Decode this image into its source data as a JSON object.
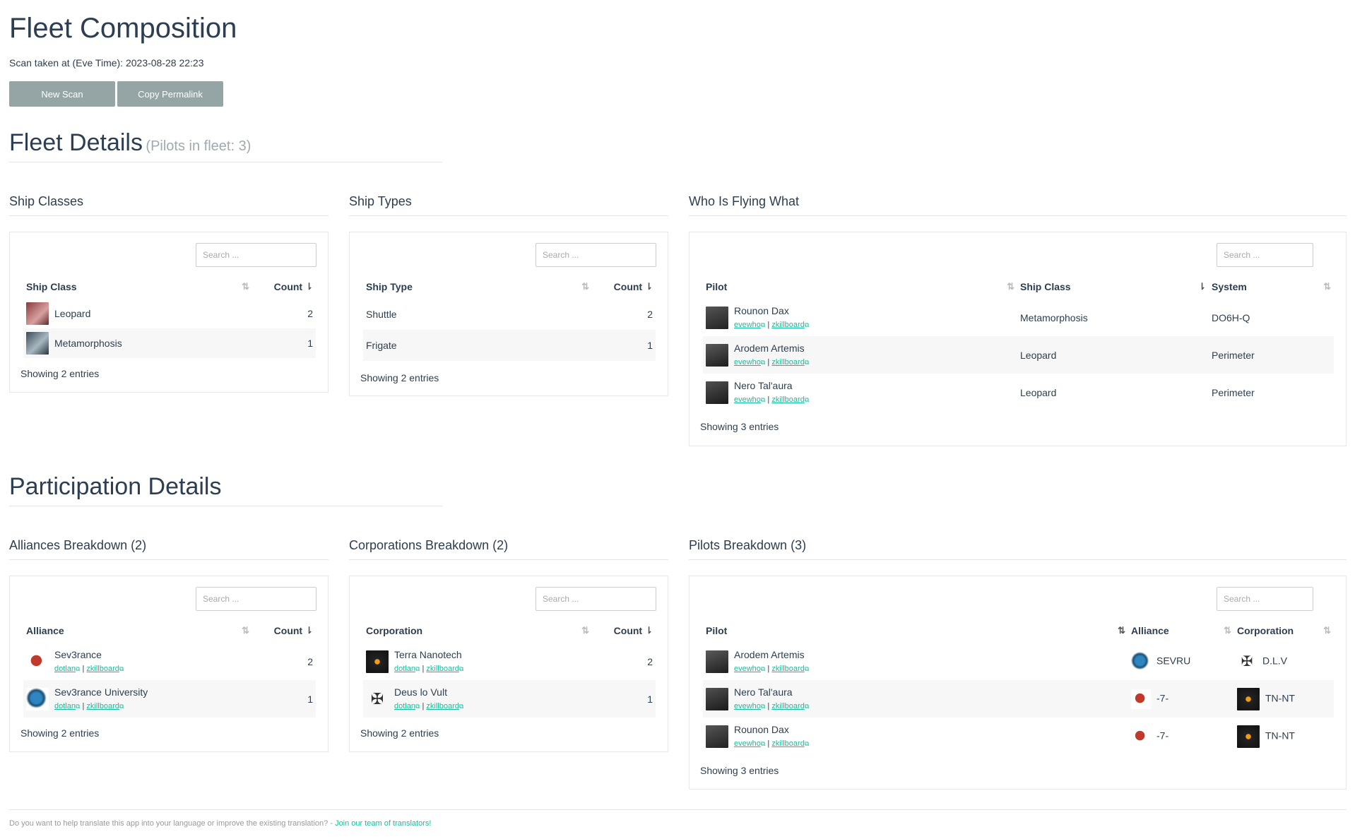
{
  "page": {
    "title": "Fleet Composition",
    "scan_time": "Scan taken at (Eve Time): 2023-08-28 22:23",
    "buttons": {
      "new_scan": "New Scan",
      "copy_permalink": "Copy Permalink"
    }
  },
  "fleet": {
    "heading": "Fleet Details",
    "pilots_count": "(Pilots in fleet: 3)",
    "ship_classes": {
      "title": "Ship Classes",
      "search_placeholder": "Search ...",
      "columns": [
        "Ship Class",
        "Count"
      ],
      "rows": [
        {
          "name": "Leopard",
          "count": "2"
        },
        {
          "name": "Metamorphosis",
          "count": "1"
        }
      ],
      "showing": "Showing 2 entries"
    },
    "ship_types": {
      "title": "Ship Types",
      "search_placeholder": "Search ...",
      "columns": [
        "Ship Type",
        "Count"
      ],
      "rows": [
        {
          "name": "Shuttle",
          "count": "2"
        },
        {
          "name": "Frigate",
          "count": "1"
        }
      ],
      "showing": "Showing 2 entries"
    },
    "who_flying": {
      "title": "Who Is Flying What",
      "search_placeholder": "Search ...",
      "columns": [
        "Pilot",
        "Ship Class",
        "System"
      ],
      "rows": [
        {
          "pilot": "Rounon Dax",
          "ship_class": "Metamorphosis",
          "system": "DO6H-Q"
        },
        {
          "pilot": "Arodem Artemis",
          "ship_class": "Leopard",
          "system": "Perimeter"
        },
        {
          "pilot": "Nero Tal'aura",
          "ship_class": "Leopard",
          "system": "Perimeter"
        }
      ],
      "showing": "Showing 3 entries"
    }
  },
  "participation": {
    "heading": "Participation Details",
    "alliances": {
      "title": "Alliances Breakdown (2)",
      "search_placeholder": "Search ...",
      "columns": [
        "Alliance",
        "Count"
      ],
      "rows": [
        {
          "name": "Sev3rance",
          "count": "2"
        },
        {
          "name": "Sev3rance University",
          "count": "1"
        }
      ],
      "showing": "Showing 2 entries"
    },
    "corporations": {
      "title": "Corporations Breakdown (2)",
      "search_placeholder": "Search ...",
      "columns": [
        "Corporation",
        "Count"
      ],
      "rows": [
        {
          "name": "Terra Nanotech",
          "count": "2"
        },
        {
          "name": "Deus lo Vult",
          "count": "1"
        }
      ],
      "showing": "Showing 2 entries"
    },
    "pilots": {
      "title": "Pilots Breakdown (3)",
      "search_placeholder": "Search ...",
      "columns": [
        "Pilot",
        "Alliance",
        "Corporation"
      ],
      "rows": [
        {
          "pilot": "Arodem Artemis",
          "alliance": "SEVRU",
          "corporation": "D.L.V"
        },
        {
          "pilot": "Nero Tal'aura",
          "alliance": "-7-",
          "corporation": "TN-NT"
        },
        {
          "pilot": "Rounon Dax",
          "alliance": "-7-",
          "corporation": "TN-NT"
        }
      ],
      "showing": "Showing 3 entries"
    }
  },
  "links": {
    "evewho": "evewho",
    "zkillboard": "zkillboard",
    "dotlan": "dotlan",
    "separator": "|"
  },
  "footer": {
    "text": "Do you want to help translate this app into your language or improve the existing translation? -",
    "link": "Join our team of translators!"
  },
  "colors": {
    "accent": "#18bc9c",
    "button": "#95a5a6",
    "text": "#2c3e50"
  }
}
